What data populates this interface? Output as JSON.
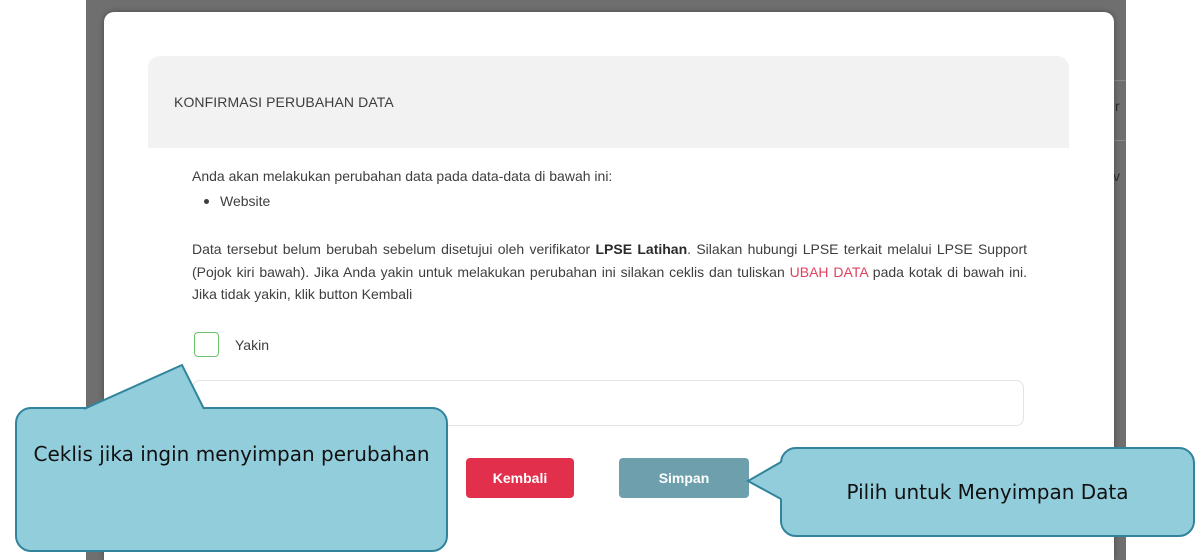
{
  "dialog": {
    "title": "KONFIRMASI PERUBAHAN DATA",
    "intro": "Anda akan melakukan perubahan data pada data-data di bawah ini:",
    "changed_items": [
      "Website"
    ],
    "paragraph": {
      "part1": "Data tersebut belum berubah sebelum disetujui oleh verifikator ",
      "bold": "LPSE Latihan",
      "part2": ". Silakan hubungi LPSE terkait melalui LPSE Support (Pojok kiri bawah). Jika Anda yakin untuk melakukan perubahan ini silakan ceklis dan tuliskan ",
      "highlight": "UBAH DATA",
      "part3": " pada kotak di bawah ini. Jika tidak yakin, klik button Kembali"
    },
    "checkbox_label": "Yakin",
    "confirm_input_value": "",
    "buttons": {
      "back_label": "Kembali",
      "save_label": "Simpan"
    }
  },
  "annotations": {
    "checkbox_callout": "Ceklis jika ingin menyimpan perubahan",
    "save_callout": "Pilih untuk Menyimpan Data"
  },
  "backdrop": {
    "fragments": [
      "r",
      "v"
    ]
  },
  "colors": {
    "back_button": "#e2304c",
    "save_button": "#6d9fac",
    "highlight_text": "#e0405d",
    "checkbox_border": "#6cc16c",
    "callout_fill": "#92cddc",
    "callout_border": "#31849b"
  }
}
